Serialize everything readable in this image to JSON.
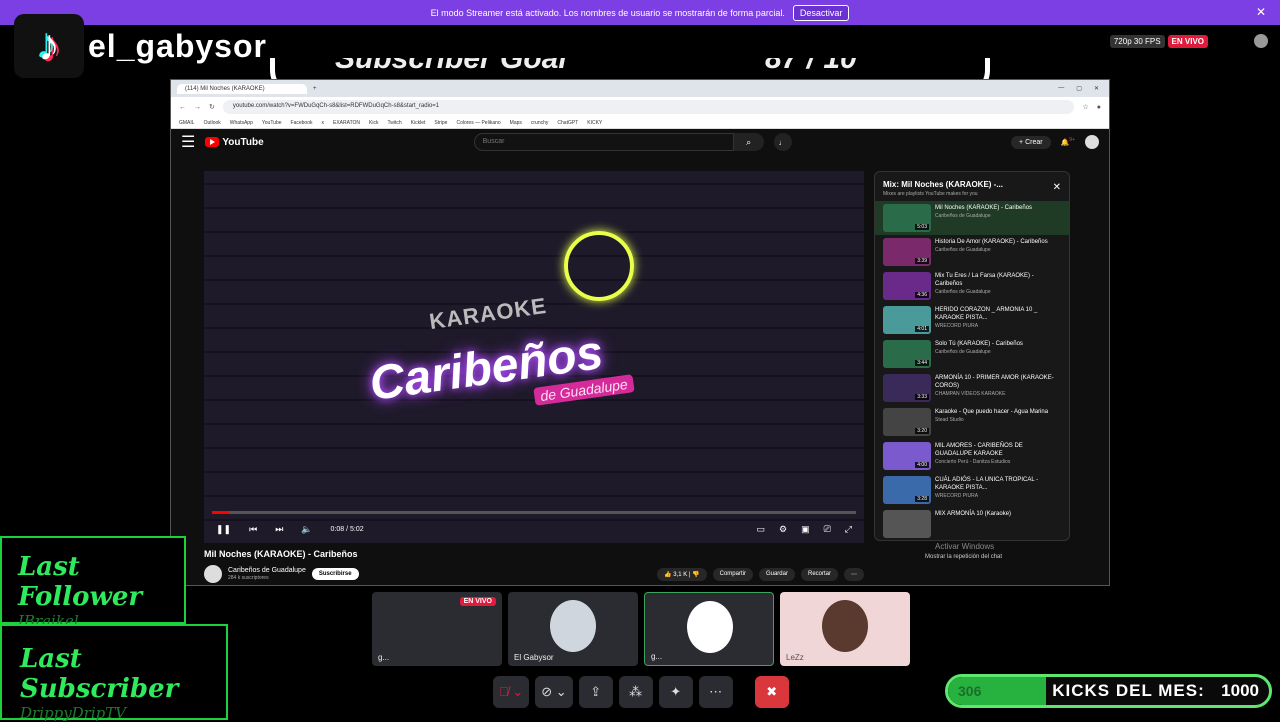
{
  "banner": {
    "message": "El modo Streamer está activado. Los nombres de usuario se mostrarán de forma parcial.",
    "button": "Desactivar",
    "close": "✕"
  },
  "stream": {
    "channel": "el_gabysor",
    "quality": "720p 30 FPS",
    "live_badge": "EN VIVO"
  },
  "overlay": {
    "left_text": "Subscriber Goal",
    "right_text": "87 / 10"
  },
  "browser": {
    "tab_title": "(114) Mil Noches (KARAOKE)",
    "url": "youtube.com/watch?v=FWDuGqCh-s8&list=RDFWDuGqCh-s8&start_radio=1",
    "bookmarks": [
      "GMAIL",
      "Outlook",
      "WhatsApp",
      "YouTube",
      "Facebook",
      "x",
      "EXARATON",
      "Kick",
      "Twitch",
      "Kicklet",
      "Stripe",
      "Colores — Pelikano",
      "Maps",
      "crunchy",
      "ChatGPT",
      "KICKY"
    ],
    "window_controls": [
      "—",
      "▢",
      "✕"
    ]
  },
  "youtube": {
    "logo": "YouTube",
    "search_placeholder": "Buscar",
    "create": "+ Crear",
    "notif_count": "9+",
    "video": {
      "karaoke_text": "KARAOKE",
      "brand_text": "Caribeños",
      "sub_text": "de Guadalupe",
      "time": "0:08 / 5:02",
      "progress": 0.027,
      "title": "Mil Noches (KARAOKE) - Caribeños",
      "channel": "Caribeños de Guadalupe",
      "subscribers": "284 k suscriptores",
      "subscribe": "Suscribirse",
      "likes": "3,1 K",
      "actions": [
        "Compartir",
        "Guardar",
        "Recortar",
        "⋯"
      ]
    },
    "playlist": {
      "title": "Mix: Mil Noches (KARAOKE) -...",
      "subtitle": "Mixes are playlists YouTube makes for you",
      "items": [
        {
          "title": "Mil Noches (KARAOKE) - Caribeños",
          "channel": "Caribeños de Guadalupe",
          "duration": "5:03"
        },
        {
          "title": "Historia De Amor (KARAOKE) - Caribeños",
          "channel": "Caribeños de Guadalupe",
          "duration": "3:39"
        },
        {
          "title": "Mix Tu Eres / La Farsa (KARAOKE) - Caribeños",
          "channel": "Caribeños de Guadalupe",
          "duration": "4:36"
        },
        {
          "title": "HERIDO CORAZON _ ARMONIA 10 _ KARAOKE PISTA...",
          "channel": "WRECORD PIURA",
          "duration": "4:01"
        },
        {
          "title": "Solo Tú (KARAOKE) - Caribeños",
          "channel": "Caribeños de Guadalupe",
          "duration": "3:44"
        },
        {
          "title": "ARMONÍA 10 - PRIMER AMOR (KARAOKE-COROS)",
          "channel": "CHAMPAN VÍDEOS KARAOKE",
          "duration": "3:33"
        },
        {
          "title": "Karaoke - Que puedo hacer - Agua Marina",
          "channel": "Stead Studio",
          "duration": "3:20"
        },
        {
          "title": "MIL AMORES - CARIBEÑOS DE GUADALUPE KARAOKE",
          "channel": "Concierto Perú - Danitza Estudios",
          "duration": "4:00"
        },
        {
          "title": "CUÁL ADIÓS - LA UNICA TROPICAL - KARAOKE PISTA...",
          "channel": "WRECORD PIURA",
          "duration": "3:28"
        },
        {
          "title": "MIX ARMONÍA 10 (Karaoke)",
          "channel": "",
          "duration": ""
        }
      ],
      "activate_windows": "Activar Windows",
      "autoplay": "Mostrar la repetición del chat"
    }
  },
  "widgets": {
    "last_follower_label": "Last Follower",
    "last_follower_value": "IBraikel",
    "last_subscriber_label": "Last Subscriber",
    "last_subscriber_value": "DrippyDripTV",
    "kicks_current": "306",
    "kicks_label": "KICKS DEL MES:",
    "kicks_goal": "1000",
    "kicks_progress": 0.306
  },
  "call": {
    "tiles": [
      {
        "name": "g...",
        "live": "EN VIVO"
      },
      {
        "name": "El Gabysor"
      },
      {
        "name": "g..."
      },
      {
        "name": "LeZz"
      }
    ]
  },
  "colors": {
    "accent": "#7b3fe4",
    "green": "#19d23c",
    "live": "#e01b3c",
    "end": "#da373c"
  }
}
